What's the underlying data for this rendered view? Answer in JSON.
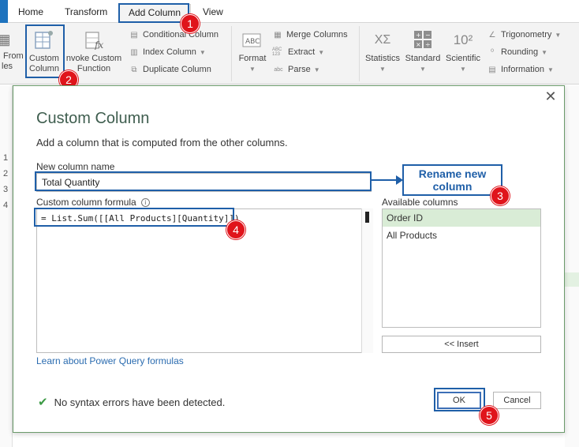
{
  "tabs": {
    "home": "Home",
    "transform": "Transform",
    "add_column": "Add Column",
    "view": "View"
  },
  "ribbon": {
    "from_examples_line1": "From",
    "from_examples_line2": "les",
    "custom_column_line1": "Custom",
    "custom_column_line2": "Column",
    "invoke_line1": "nvoke Custom",
    "invoke_line2": "Function",
    "conditional_column": "Conditional Column",
    "index_column": "Index Column",
    "duplicate_column": "Duplicate Column",
    "format": "Format",
    "merge_columns": "Merge Columns",
    "extract": "Extract",
    "parse": "Parse",
    "statistics": "Statistics",
    "standard": "Standard",
    "scientific": "Scientific",
    "trigonometry": "Trigonometry",
    "rounding": "Rounding",
    "information": "Information",
    "scientific_icon_text": "10²",
    "statistics_icon_text": "XΣ",
    "abc_text": "ABC",
    "abc123_text": "ABC 123",
    "abc_small_text": "abc"
  },
  "background": {
    "row_numbers": [
      "1",
      "2",
      "3",
      "4"
    ]
  },
  "dialog": {
    "title": "Custom Column",
    "subtitle": "Add a column that is computed from the other columns.",
    "name_label": "New column name",
    "name_value": "Total Quantity",
    "formula_label": "Custom column formula",
    "formula_value": "= List.Sum([[All Products][Quantity]])",
    "available_label": "Available columns",
    "available_columns": [
      "Order ID",
      "All Products"
    ],
    "insert_button": "<< Insert",
    "learn_link": "Learn about Power Query formulas",
    "status_text": "No syntax errors have been detected.",
    "ok_button": "OK",
    "cancel_button": "Cancel"
  },
  "annotations": {
    "callout_text": "Rename new column",
    "step_numbers": [
      "1",
      "2",
      "3",
      "4",
      "5"
    ]
  },
  "colors": {
    "annotation_blue": "#1f5fa8",
    "step_red": "#e0141b",
    "selected_green": "#d9ecd6",
    "title_green": "#3f5e4f"
  }
}
